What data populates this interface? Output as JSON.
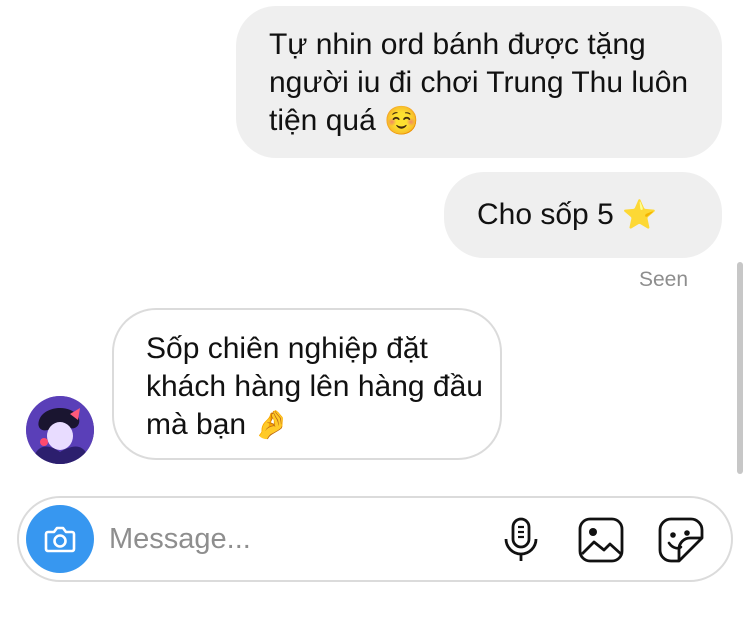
{
  "messages": [
    {
      "direction": "sent",
      "text": "Tự nhin ord bánh được tặng người iu đi chơi Trung Thu luôn tiện quá",
      "emoji": "☺️"
    },
    {
      "direction": "sent",
      "text": "Cho sốp 5",
      "emoji": "⭐"
    },
    {
      "direction": "received",
      "text": "Sốp chiên nghiệp đặt khách hàng lên hàng đầu mà bạn",
      "emoji": "🤌"
    }
  ],
  "read_receipt": "Seen",
  "composer": {
    "placeholder": "Message..."
  },
  "icons": {
    "camera": "camera-icon",
    "mic": "microphone-icon",
    "gallery": "image-gallery-icon",
    "sticker": "sticker-icon",
    "avatar": "user-avatar"
  },
  "colors": {
    "sent_bubble": "#efefef",
    "received_border": "#dbdbdb",
    "camera_button": "#3797f0",
    "seen_text": "#8e8e8e"
  }
}
